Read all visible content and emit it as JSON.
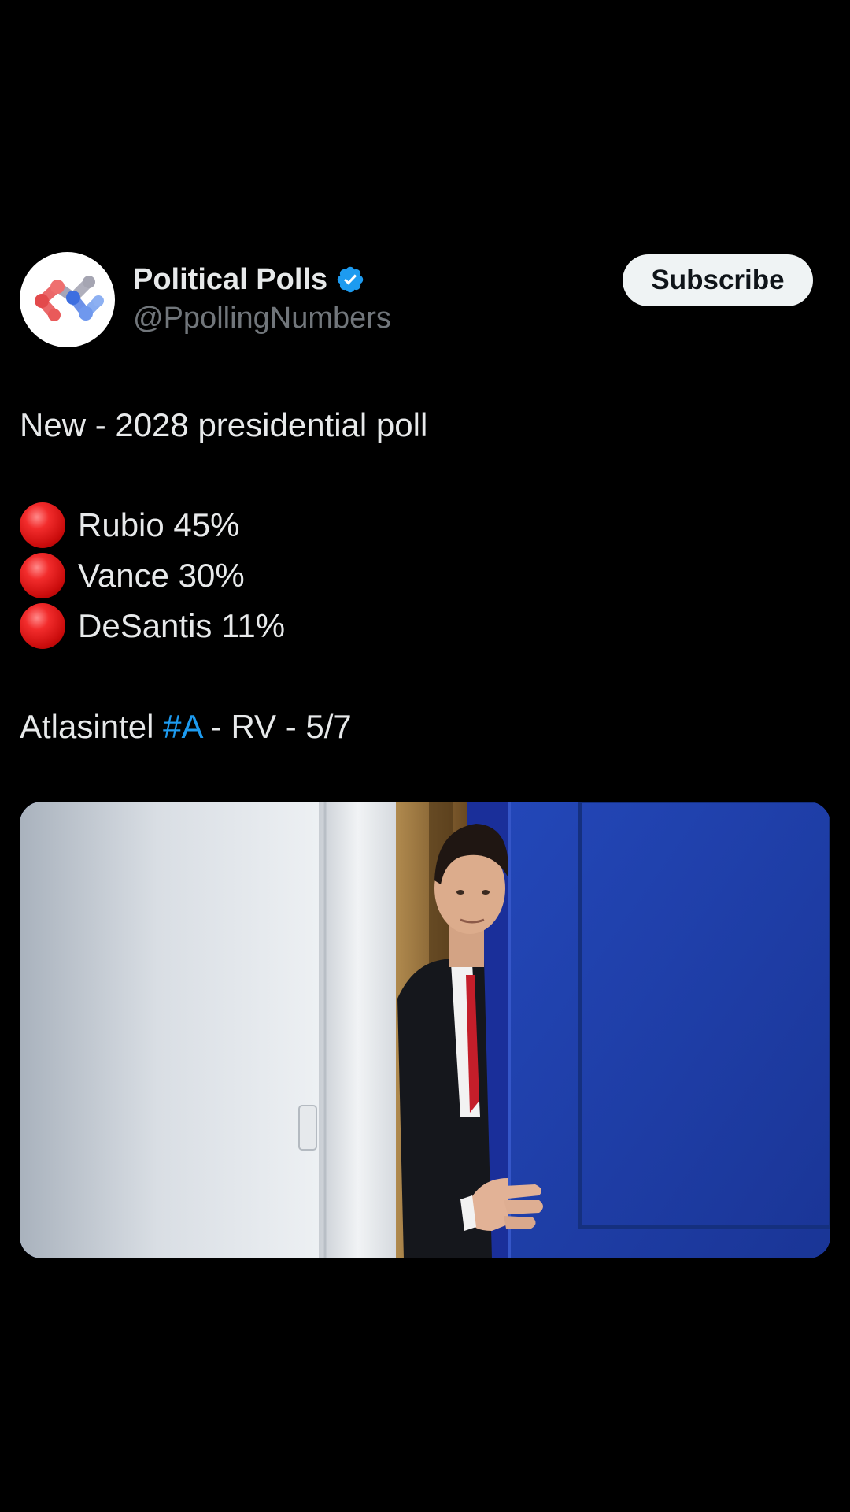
{
  "header": {
    "display_name": "Political Polls",
    "handle": "@PpollingNumbers",
    "subscribe_label": "Subscribe",
    "avatar_icon": "network-logo-icon",
    "verified_icon": "verified-badge-icon"
  },
  "post": {
    "headline": "New - 2028 presidential poll",
    "poll_results": [
      {
        "marker_icon": "red-circle-icon",
        "text": "Rubio 45%"
      },
      {
        "marker_icon": "red-circle-icon",
        "text": "Vance 30%"
      },
      {
        "marker_icon": "red-circle-icon",
        "text": "DeSantis 11%"
      }
    ],
    "source_prefix": "Atlasintel ",
    "source_hashtag": "#A",
    "source_suffix": " - RV - 5/7"
  },
  "media": {
    "description_icon": "photo-man-behind-blue-door"
  },
  "colors": {
    "background": "#000000",
    "text": "#e7e9ea",
    "muted": "#71767b",
    "link": "#1d9bf0",
    "verified": "#1d9bf0",
    "button_bg": "#eff3f4",
    "door_blue": "#1d3fb0"
  }
}
